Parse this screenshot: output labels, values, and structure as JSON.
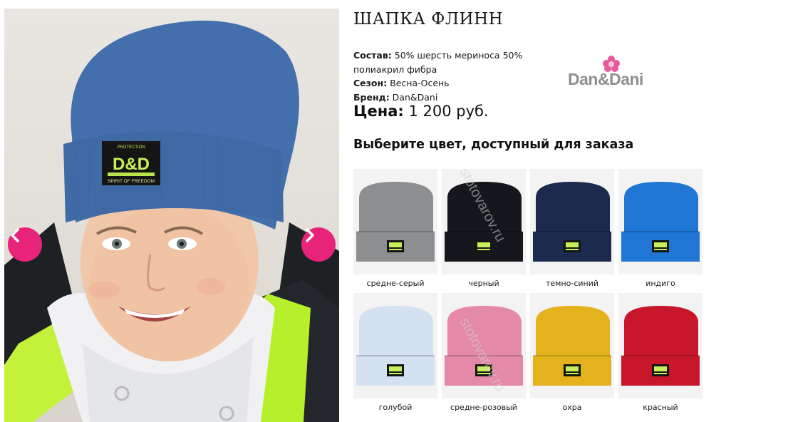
{
  "product": {
    "title": "ШАПКА ФЛИНН",
    "composition_label": "Состав",
    "composition_value": "50% шерсть мериноса 50% полиакрил фибра",
    "season_label": "Сезон",
    "season_value": "Весна-Осень",
    "brand_label": "Бренд",
    "brand_value": "Dan&Dani",
    "price_label": "Цена",
    "price_value": "1 200 руб."
  },
  "brand_logo": {
    "text": "Dan&Dani"
  },
  "gallery": {
    "prev_icon": "chevron-left-icon",
    "next_icon": "chevron-right-icon",
    "hat_patch_text": "D&D",
    "hat_patch_top": "PROTECTION",
    "hat_patch_bottom": "SPIRIT OF FREEDOM",
    "accent": "#e8247a"
  },
  "colors_heading": "Выберите цвет, доступный для заказа",
  "colors": [
    {
      "name": "средне-серый",
      "hex": "#8d8e90"
    },
    {
      "name": "черный",
      "hex": "#15171c"
    },
    {
      "name": "темно-синий",
      "hex": "#1b2a4d"
    },
    {
      "name": "индиго",
      "hex": "#1f76d4"
    },
    {
      "name": "голубой",
      "hex": "#d4e1f1"
    },
    {
      "name": "средне-розовый",
      "hex": "#e48aa8"
    },
    {
      "name": "охра",
      "hex": "#e3b21c"
    },
    {
      "name": "красный",
      "hex": "#c8172b"
    }
  ],
  "watermark": "stotovarov.ru"
}
